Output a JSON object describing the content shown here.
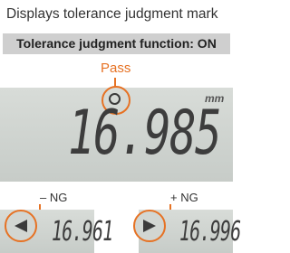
{
  "heading": "Displays tolerance judgment mark",
  "function_status": "Tolerance judgment function: ON",
  "pass": {
    "label": "Pass",
    "reading": "16.985",
    "unit": "mm"
  },
  "lower_ng": {
    "label": "– NG",
    "reading": "16.961"
  },
  "upper_ng": {
    "label": "+ NG",
    "reading": "16.996"
  },
  "colors": {
    "accent": "#e67224",
    "lcd_background": "#cfd3cf",
    "segment": "#3d3d3d"
  },
  "icons": {
    "pass_mark": "circle-icon",
    "lower_ng_mark": "left-triangle-icon",
    "upper_ng_mark": "right-triangle-icon"
  }
}
